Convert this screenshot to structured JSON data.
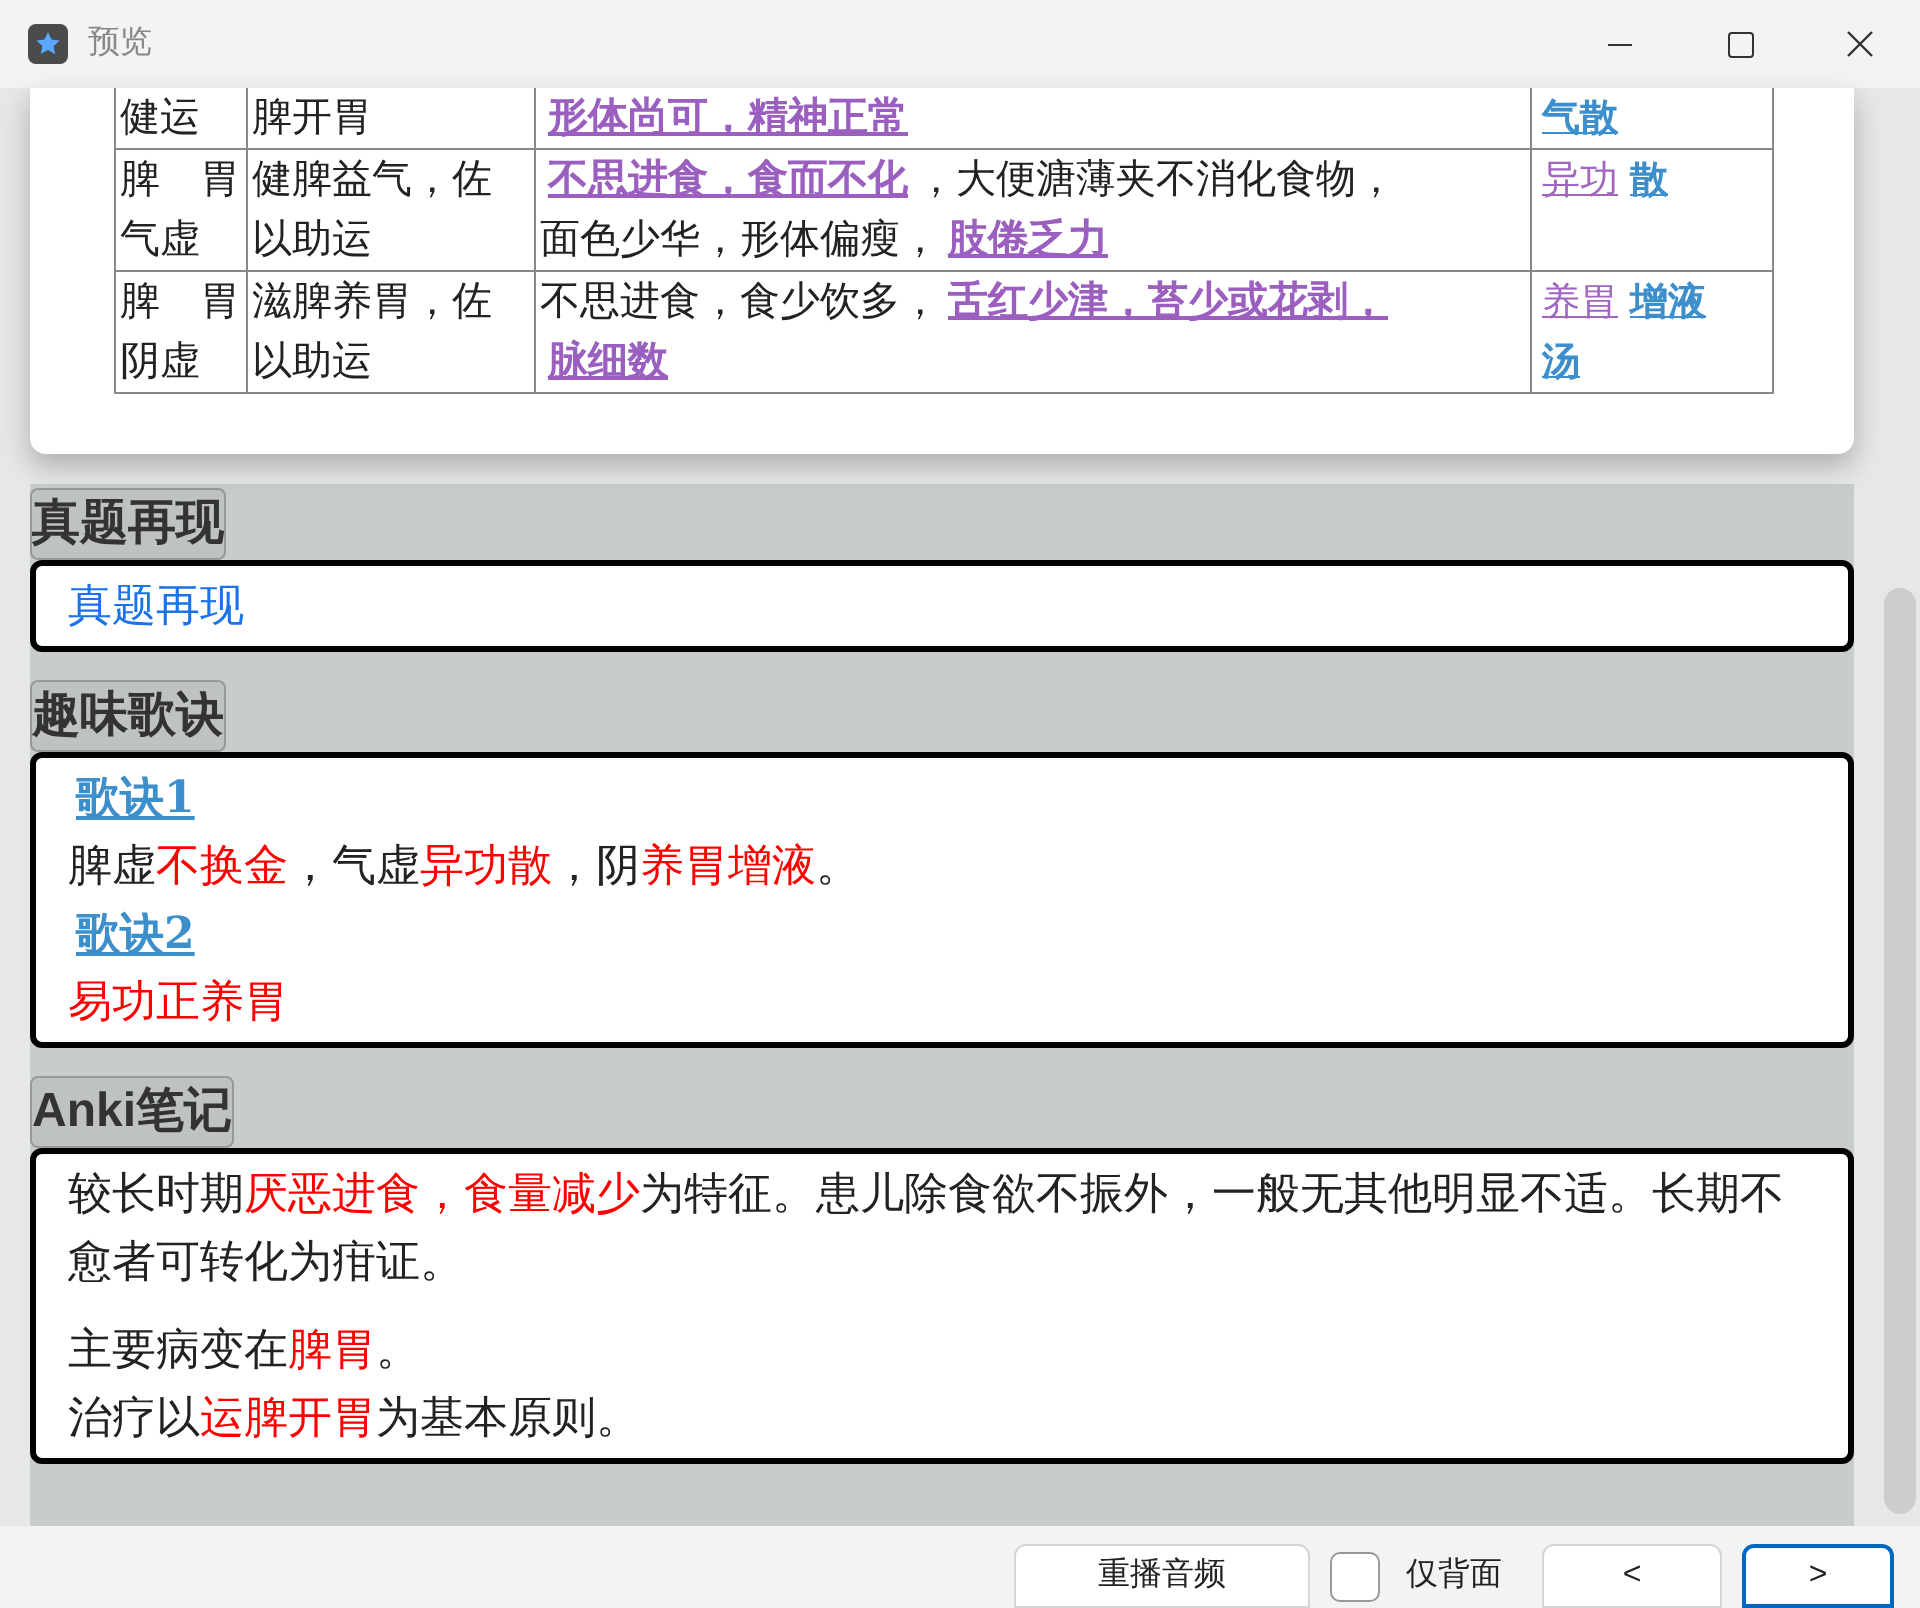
{
  "window": {
    "title": "预览"
  },
  "table": {
    "rows": [
      {
        "cells": [
          [
            [
              {
                "text": "健运",
                "kind": "plain"
              }
            ]
          ],
          [
            [
              {
                "text": "脾开胃",
                "kind": "plain"
              }
            ]
          ],
          [
            [
              {
                "text": "形体尚可，精神正常",
                "kind": "visited"
              }
            ]
          ],
          [
            [
              {
                "text": "气散",
                "kind": "remedy"
              }
            ]
          ]
        ]
      },
      {
        "cells": [
          [
            [
              {
                "text": "脾　胃",
                "kind": "plain"
              }
            ],
            [
              {
                "text": "气虚",
                "kind": "plain"
              }
            ]
          ],
          [
            [
              {
                "text": "健脾益气，佐",
                "kind": "plain"
              }
            ],
            [
              {
                "text": "以助运",
                "kind": "plain"
              }
            ]
          ],
          [
            [
              {
                "text": "不思进食，食而不化",
                "kind": "visited"
              },
              {
                "text": "，大便溏薄夹不消化食物，",
                "kind": "plain"
              }
            ],
            [
              {
                "text": "面色少华，形体偏瘦，",
                "kind": "plain"
              },
              {
                "text": "肢倦乏力",
                "kind": "visited"
              }
            ]
          ],
          [
            [
              {
                "text": "异功",
                "kind": "remedy_visited"
              },
              {
                "text": "散",
                "kind": "remedy"
              }
            ]
          ]
        ]
      },
      {
        "cells": [
          [
            [
              {
                "text": "脾　胃",
                "kind": "plain"
              }
            ],
            [
              {
                "text": "阴虚",
                "kind": "plain"
              }
            ]
          ],
          [
            [
              {
                "text": "滋脾养胃，佐",
                "kind": "plain"
              }
            ],
            [
              {
                "text": "以助运",
                "kind": "plain"
              }
            ]
          ],
          [
            [
              {
                "text": "不思进食，食少饮多，",
                "kind": "plain"
              },
              {
                "text": "舌红少津，苔少或花剥，",
                "kind": "visited"
              }
            ],
            [
              {
                "text": "脉细数",
                "kind": "visited"
              }
            ]
          ],
          [
            [
              {
                "text": "养胃",
                "kind": "remedy_visited"
              },
              {
                "text": "增液",
                "kind": "remedy"
              }
            ],
            [
              {
                "text": "汤",
                "kind": "remedy"
              }
            ]
          ]
        ]
      }
    ]
  },
  "sections": [
    {
      "title": "真题再现",
      "blocks": [
        [
          [
            {
              "text": "真题再现",
              "kind": "blue"
            }
          ]
        ]
      ]
    },
    {
      "title": "趣味歌诀",
      "blocks": [
        [
          [
            {
              "text": "歌诀1",
              "kind": "heading_link"
            }
          ],
          [
            {
              "text": "脾虚",
              "kind": "plain"
            },
            {
              "text": "不换金",
              "kind": "red"
            },
            {
              "text": "，气虚",
              "kind": "plain"
            },
            {
              "text": "异功散",
              "kind": "red"
            },
            {
              "text": "，阴",
              "kind": "plain"
            },
            {
              "text": "养胃增液",
              "kind": "red"
            },
            {
              "text": "。",
              "kind": "plain"
            }
          ],
          [
            {
              "text": "歌诀2",
              "kind": "heading_link"
            }
          ],
          [
            {
              "text": "易功正养胃",
              "kind": "red"
            }
          ]
        ]
      ]
    },
    {
      "title": "Anki笔记",
      "blocks": [
        [
          [
            {
              "text": "较长时期",
              "kind": "plain"
            },
            {
              "text": "厌恶进食，食量减少",
              "kind": "red"
            },
            {
              "text": "为特征。患儿除食欲不振外，一般无其他明显不适。长期不愈者可转化为疳证。",
              "kind": "plain"
            }
          ]
        ],
        [
          [
            {
              "text": "主要病变在",
              "kind": "plain"
            },
            {
              "text": "脾胃",
              "kind": "red"
            },
            {
              "text": "。",
              "kind": "plain"
            }
          ],
          [
            {
              "text": "治疗以",
              "kind": "plain"
            },
            {
              "text": "运脾开胃",
              "kind": "red"
            },
            {
              "text": "为基本原则。",
              "kind": "plain"
            }
          ]
        ]
      ]
    }
  ],
  "bottom_bar": {
    "replay_button": "重播音频",
    "back_only": {
      "label": "仅背面",
      "checked": false
    },
    "nav_buttons": [
      {
        "label": "<",
        "focused": false
      },
      {
        "label": ">",
        "focused": true
      }
    ]
  }
}
